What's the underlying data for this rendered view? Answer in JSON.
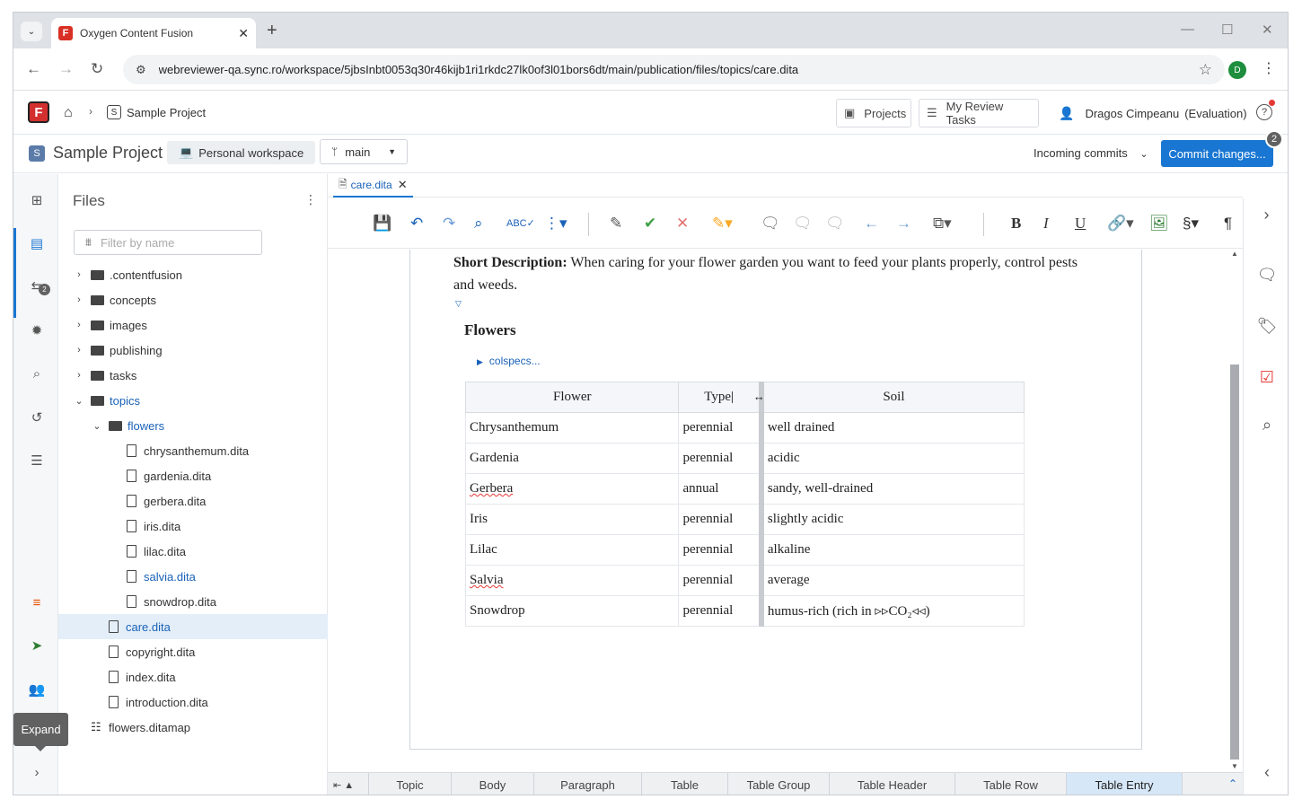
{
  "browser": {
    "tab_title": "Oxygen Content Fusion",
    "url": "webreviewer-qa.sync.ro/workspace/5jbsInbt0053q30r46kijb1ri1rkdc27lk0of3l01bors6dt/main/publication/files/topics/care.dita",
    "profile_initial": "D"
  },
  "app_header": {
    "logo": "F",
    "breadcrumb_project": "Sample Project",
    "projects_label": "Projects",
    "review_tasks_label": "My Review Tasks",
    "user_name": "Dragos Cimpeanu",
    "user_status": "(Evaluation)"
  },
  "project_bar": {
    "badge": "S",
    "project_name": "Sample Project",
    "workspace_label": "Personal workspace",
    "branch": "main",
    "incoming_label": "Incoming commits",
    "commit_label": "Commit changes...",
    "commit_count": "2"
  },
  "rail": {
    "notifications_badge": "2",
    "expand_tooltip": "Expand"
  },
  "files": {
    "title": "Files",
    "filter_placeholder": "Filter by name",
    "tree": [
      {
        "label": ".contentfusion",
        "kind": "folder",
        "depth": 0,
        "expanded": false
      },
      {
        "label": "concepts",
        "kind": "folder",
        "depth": 0,
        "expanded": false
      },
      {
        "label": "images",
        "kind": "folder",
        "depth": 0,
        "expanded": false
      },
      {
        "label": "publishing",
        "kind": "folder",
        "depth": 0,
        "expanded": false
      },
      {
        "label": "tasks",
        "kind": "folder",
        "depth": 0,
        "expanded": false
      },
      {
        "label": "topics",
        "kind": "folder",
        "depth": 0,
        "expanded": true
      },
      {
        "label": "flowers",
        "kind": "folder",
        "depth": 1,
        "expanded": true
      },
      {
        "label": "chrysanthemum.dita",
        "kind": "file",
        "depth": 2
      },
      {
        "label": "gardenia.dita",
        "kind": "file",
        "depth": 2
      },
      {
        "label": "gerbera.dita",
        "kind": "file",
        "depth": 2
      },
      {
        "label": "iris.dita",
        "kind": "file",
        "depth": 2
      },
      {
        "label": "lilac.dita",
        "kind": "file",
        "depth": 2
      },
      {
        "label": "salvia.dita",
        "kind": "file",
        "depth": 2
      },
      {
        "label": "snowdrop.dita",
        "kind": "file",
        "depth": 2
      },
      {
        "label": "care.dita",
        "kind": "file",
        "depth": 1
      },
      {
        "label": "copyright.dita",
        "kind": "file",
        "depth": 1
      },
      {
        "label": "index.dita",
        "kind": "file",
        "depth": 1
      },
      {
        "label": "introduction.dita",
        "kind": "file",
        "depth": 1
      },
      {
        "label": "flowers.ditamap",
        "kind": "map",
        "depth": 0
      }
    ]
  },
  "editor": {
    "tab_name": "care.dita",
    "short_desc_label": "Short Description:",
    "short_desc_text": " When caring for your flower garden you want to feed your plants properly, control pests and weeds.",
    "section_title": "Flowers",
    "colspecs_label": "colspecs...",
    "table": {
      "headers": [
        "Flower",
        "Type",
        "Soil"
      ],
      "rows": [
        [
          "Chrysanthemum",
          "perennial",
          "well drained"
        ],
        [
          "Gardenia",
          "perennial",
          "acidic"
        ],
        [
          "Gerbera",
          "annual",
          "sandy, well-drained"
        ],
        [
          "Iris",
          "perennial",
          "slightly acidic"
        ],
        [
          "Lilac",
          "perennial",
          "alkaline"
        ],
        [
          "Salvia",
          "perennial",
          "average"
        ],
        [
          "Snowdrop",
          "perennial",
          "humus-rich (rich in ▹▹CO₂◃◃)"
        ]
      ]
    }
  },
  "element_path": [
    "Topic",
    "Body",
    "Paragraph",
    "Table",
    "Table Group",
    "Table Header",
    "Table Row",
    "Table Entry"
  ],
  "colors": {
    "accent": "#1976d2",
    "logo_red": "#d32f2f",
    "active_path": "#d6e7f8"
  }
}
